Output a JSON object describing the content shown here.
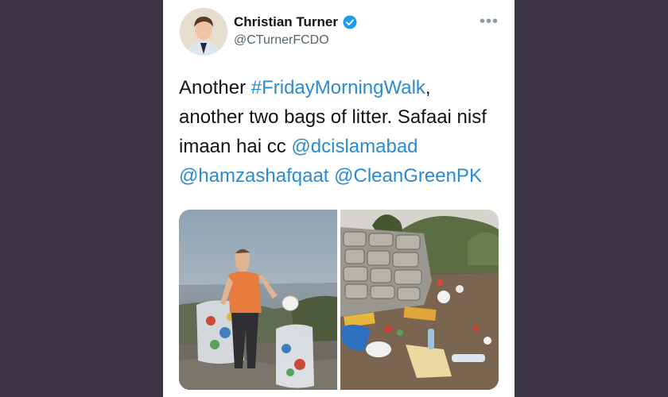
{
  "tweet": {
    "author_name": "Christian Turner",
    "author_handle": "@CTurnerFCDO",
    "text_parts": [
      "Another ",
      "#FridayMorningWalk",
      ",",
      "another two bags of litter. Safaai nisf",
      "imaan hai cc ",
      "@dcislamabad",
      "@hamzashafqaat",
      " ",
      "@CleanGreenPK"
    ],
    "more_label": "•••"
  },
  "icons": {
    "verified": "verified-badge-icon",
    "more": "more-options-icon"
  },
  "colors": {
    "background": "#3a3444",
    "link": "#2a8bd0",
    "verified": "#1d9bf0"
  }
}
